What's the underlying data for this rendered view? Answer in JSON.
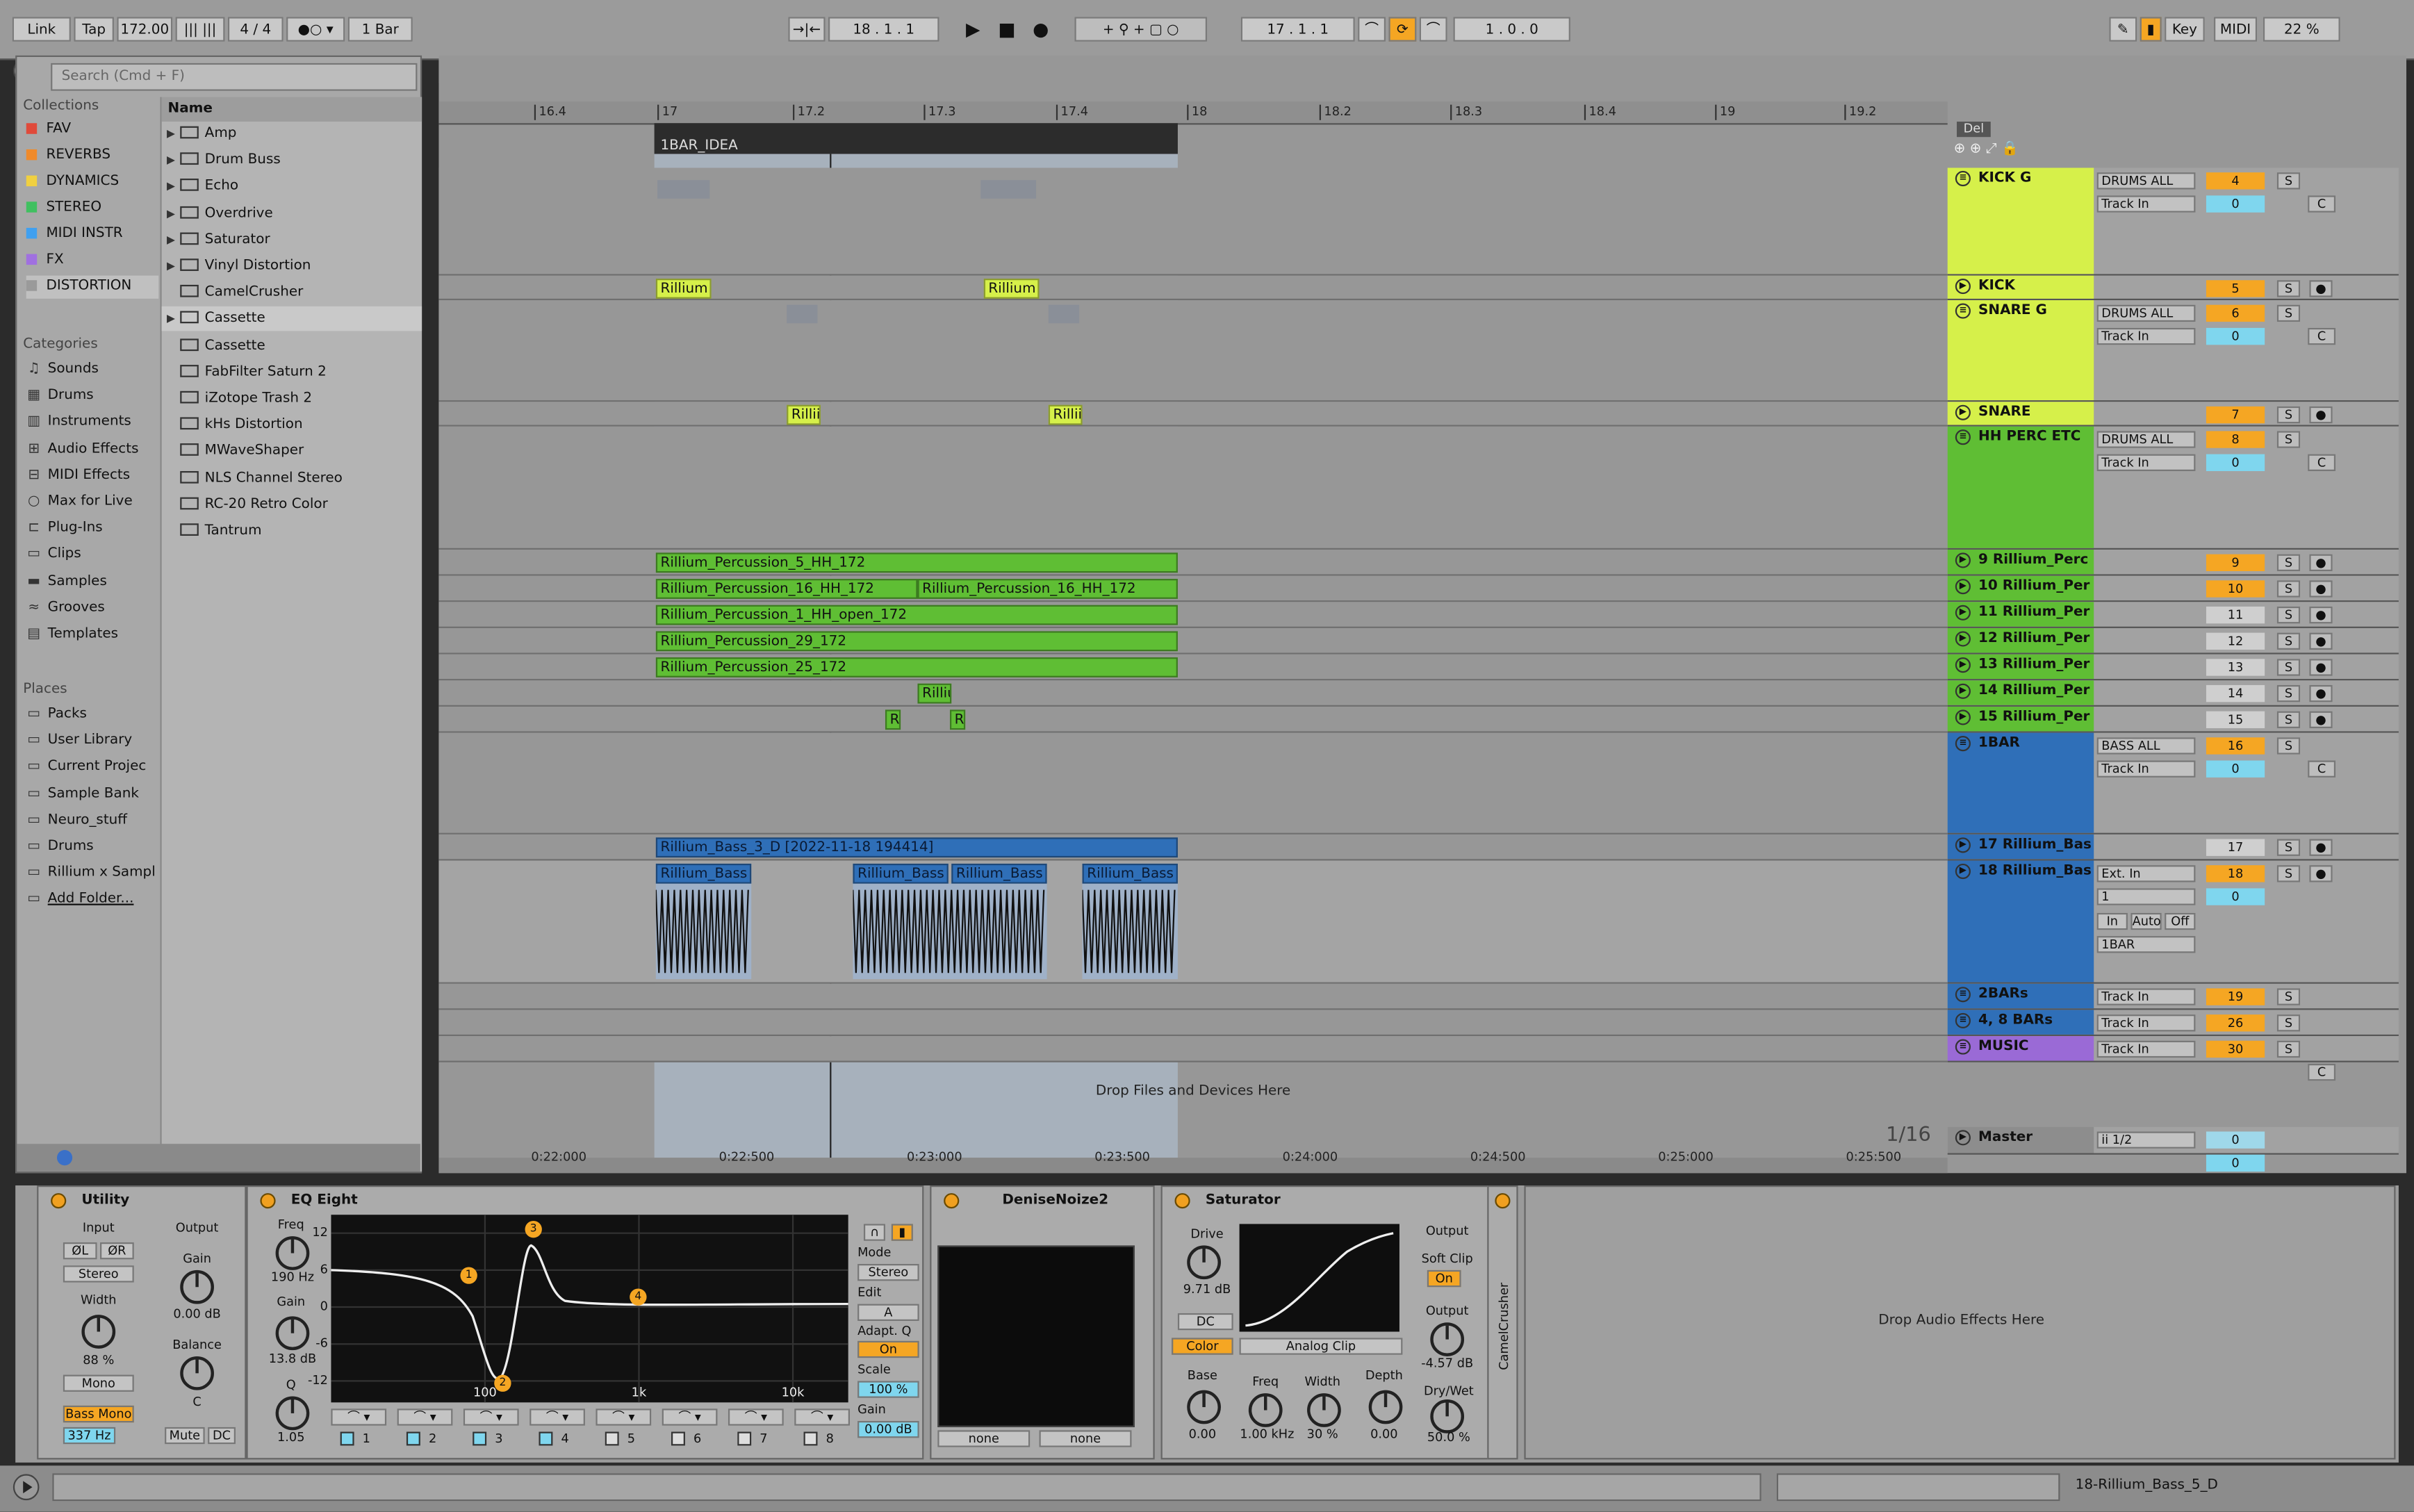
{
  "transport": {
    "link": "Link",
    "tap": "Tap",
    "tempo": "172.00",
    "signature": "4 / 4",
    "quantize": "1 Bar",
    "position": "18 . 1 . 1",
    "loop_start": "17 . 1 . 1",
    "loop_length": "1 . 0 . 0",
    "key": "Key",
    "midi": "MIDI",
    "cpu": "22 %"
  },
  "browser": {
    "search_placeholder": "Search (Cmd + F)",
    "collections_heading": "Collections",
    "collections": [
      {
        "label": "FAV",
        "color": "#e04a3a"
      },
      {
        "label": "REVERBS",
        "color": "#f08a2a"
      },
      {
        "label": "DYNAMICS",
        "color": "#f0d040"
      },
      {
        "label": "STEREO",
        "color": "#40c060"
      },
      {
        "label": "MIDI INSTR",
        "color": "#40a0f0"
      },
      {
        "label": "FX",
        "color": "#a070e0"
      },
      {
        "label": "DISTORTION",
        "color": "#9a9a9a"
      }
    ],
    "categories_heading": "Categories",
    "categories": [
      "Sounds",
      "Drums",
      "Instruments",
      "Audio Effects",
      "MIDI Effects",
      "Max for Live",
      "Plug-Ins",
      "Clips",
      "Samples",
      "Grooves",
      "Templates"
    ],
    "places_heading": "Places",
    "places": [
      "Packs",
      "User Library",
      "Current Projec",
      "Sample Bank",
      "Neuro_stuff",
      "Drums",
      "Rillium x Sampl",
      "Add Folder..."
    ],
    "name_header": "Name",
    "items": [
      "Amp",
      "Drum Buss",
      "Echo",
      "Overdrive",
      "Saturator",
      "Vinyl Distortion",
      "CamelCrusher",
      "Cassette",
      "Cassette",
      "FabFilter Saturn 2",
      "iZotope Trash 2",
      "kHs Distortion",
      "MWaveShaper",
      "NLS Channel Stereo",
      "RC-20 Retro Color",
      "Tantrum"
    ]
  },
  "ruler": {
    "bars": [
      "16.4",
      "17",
      "17.2",
      "17.3",
      "17.4",
      "18",
      "18.2",
      "18.3",
      "18.4",
      "19",
      "19.2"
    ],
    "times": [
      "0:22:000",
      "0:22:500",
      "0:23:000",
      "0:23:500",
      "0:24:000",
      "0:24:500",
      "0:25:000",
      "0:25:500"
    ],
    "locator": "1BAR_IDEA",
    "grid": "1/16",
    "drop_files": "Drop Files and Devices Here",
    "del": "Del"
  },
  "clips": {
    "rillium": "Rillium",
    "rilli": "Rillii",
    "perc_5": "Rillium_Percussion_5_HH_172",
    "perc_16a": "Rillium_Percussion_16_HH_172",
    "perc_16b": "Rillium_Percussion_16_HH_172",
    "perc_1": "Rillium_Percussion_1_HH_open_172",
    "perc_29": "Rillium_Percussion_29_172",
    "perc_25": "Rillium_Percussion_25_172",
    "rilliu": "Rilliu",
    "r": "R",
    "bass_3d": "Rillium_Bass_3_D [2022-11-18 194414]",
    "bass": "Rillium_Bass"
  },
  "tracks": [
    {
      "name": "KICK G",
      "input": "DRUMS ALL",
      "sub": "Track In",
      "num": "4",
      "sub_num": "0"
    },
    {
      "name": "KICK",
      "num": "5"
    },
    {
      "name": "SNARE G",
      "input": "DRUMS ALL",
      "sub": "Track In",
      "num": "6",
      "sub_num": "0"
    },
    {
      "name": "SNARE",
      "num": "7"
    },
    {
      "name": "HH PERC ETC",
      "input": "DRUMS ALL",
      "sub": "Track In",
      "num": "8",
      "sub_num": "0"
    },
    {
      "name": "9 Rillium_Perc",
      "num": "9"
    },
    {
      "name": "10 Rillium_Per",
      "num": "10"
    },
    {
      "name": "11 Rillium_Per",
      "num": "11"
    },
    {
      "name": "12 Rillium_Per",
      "num": "12"
    },
    {
      "name": "13 Rillium_Per",
      "num": "13"
    },
    {
      "name": "14 Rillium_Per",
      "num": "14"
    },
    {
      "name": "15 Rillium_Per",
      "num": "15"
    },
    {
      "name": "1BAR",
      "input": "BASS ALL",
      "sub": "Track In",
      "num": "16",
      "sub_num": "0"
    },
    {
      "name": "17 Rillium_Bas",
      "num": "17"
    },
    {
      "name": "18 Rillium_Bas",
      "input": "Ext. In",
      "sub": "1",
      "num": "18",
      "sub_num": "0",
      "monitor": [
        "In",
        "Auto",
        "Off"
      ],
      "out": "1BAR"
    },
    {
      "name": "2BARs",
      "input": "Track In",
      "num": "19"
    },
    {
      "name": "4, 8 BARs",
      "input": "Track In",
      "num": "26"
    },
    {
      "name": "MUSIC",
      "input": "Track In",
      "num": "30"
    },
    {
      "name": "Master",
      "input": "ii 1/2",
      "num": "0",
      "sub_num": "0"
    }
  ],
  "track_buttons": {
    "solo": "S",
    "cue": "C"
  },
  "devices": {
    "utility": {
      "title": "Utility",
      "input": "Input",
      "output": "Output",
      "phase_l": "ØL",
      "phase_r": "ØR",
      "channel": "Stereo",
      "gain_label": "Gain",
      "gain": "0.00 dB",
      "width_label": "Width",
      "width": "88 %",
      "balance_label": "Balance",
      "balance": "C",
      "mono": "Mono",
      "bass_mono": "Bass Mono",
      "freq": "337 Hz",
      "mute": "Mute",
      "dc": "DC"
    },
    "eq": {
      "title": "EQ Eight",
      "freq_label": "Freq",
      "freq": "190 Hz",
      "gain_label": "Gain",
      "gain": "13.8 dB",
      "q_label": "Q",
      "q": "1.05",
      "db_ticks": [
        "12",
        "6",
        "0",
        "-6",
        "-12"
      ],
      "hz_ticks": [
        "100",
        "1k",
        "10k"
      ],
      "mode_label": "Mode",
      "mode": "Stereo",
      "edit_label": "Edit",
      "edit": "A",
      "adapt_label": "Adapt. Q",
      "adapt": "On",
      "scale_label": "Scale",
      "scale": "100 %",
      "out_gain_label": "Gain",
      "out_gain": "0.00 dB",
      "bands": [
        "1",
        "2",
        "3",
        "4",
        "5",
        "6",
        "7",
        "8"
      ],
      "nodes": [
        "1",
        "2",
        "3",
        "4"
      ]
    },
    "denise": {
      "title": "DeniseNoize2",
      "sel_a": "none",
      "sel_b": "none"
    },
    "saturator": {
      "title": "Saturator",
      "drive_label": "Drive",
      "drive": "9.71 dB",
      "dc": "DC",
      "color": "Color",
      "type": "Analog Clip",
      "output_label": "Output",
      "soft_clip": "Soft Clip",
      "soft_clip_state": "On",
      "output": "-4.57 dB",
      "base_label": "Base",
      "base": "0.00",
      "freq_label": "Freq",
      "freq": "1.00 kHz",
      "width_label": "Width",
      "width": "30 %",
      "depth_label": "Depth",
      "depth": "0.00",
      "drywet_label": "Dry/Wet",
      "drywet": "50.0 %"
    },
    "camel": {
      "title": "CamelCrusher"
    },
    "drop_audio": "Drop Audio Effects Here"
  },
  "status": {
    "selected_track": "18-Rillium_Bass_5_D"
  },
  "colors": {
    "kick": "#d6f04a",
    "perc": "#5fbe34",
    "bass": "#2f6fb8",
    "music": "#9a6ad6",
    "orange": "#f5a623",
    "cyan": "#7fd6ee"
  }
}
